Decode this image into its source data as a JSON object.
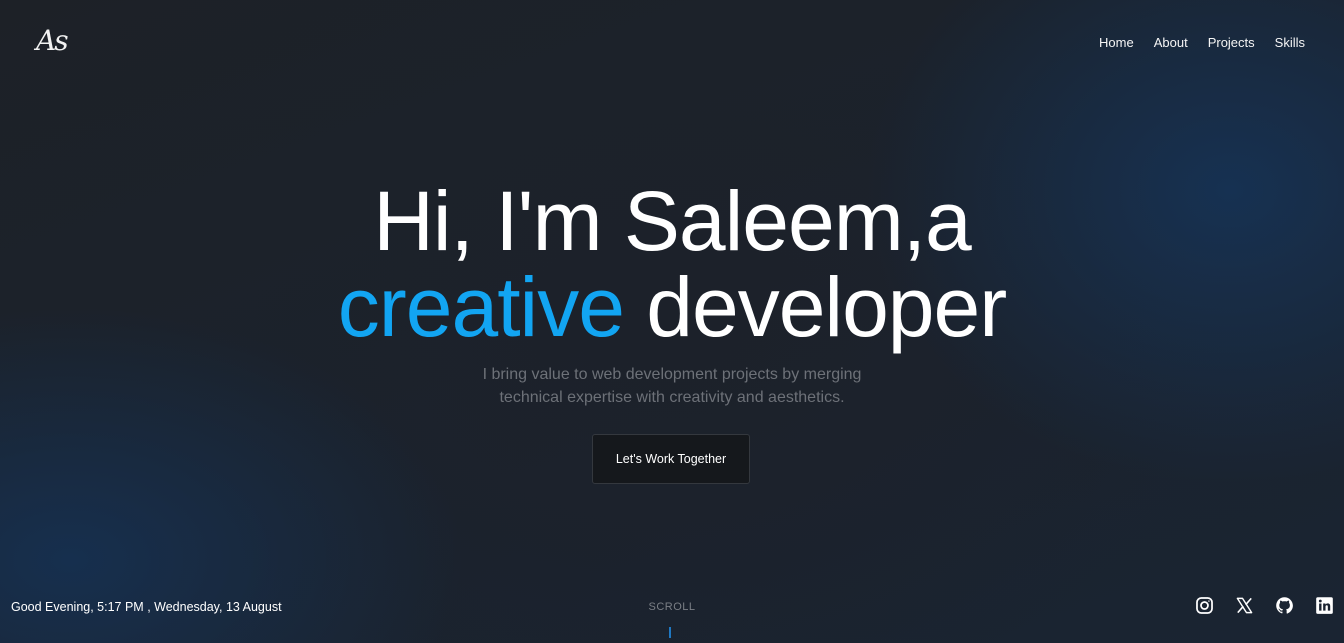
{
  "header": {
    "logo_text": "As",
    "nav": [
      {
        "label": "Home"
      },
      {
        "label": "About"
      },
      {
        "label": "Projects"
      },
      {
        "label": "Skills"
      }
    ]
  },
  "hero": {
    "line1": "Hi, I'm Saleem,a",
    "accent_word": "creative",
    "line2_rest": " developer",
    "subtitle_line1": "I bring value to web development projects by merging",
    "subtitle_line2": "technical expertise with creativity and aesthetics.",
    "cta_label": "Let's Work Together"
  },
  "footer": {
    "greeting": "Good Evening, 5:17 PM , Wednesday, 13 August",
    "scroll_label": "SCROLL",
    "social_icons": [
      "instagram-icon",
      "x-icon",
      "github-icon",
      "linkedin-icon"
    ]
  },
  "colors": {
    "accent": "#12a5f2",
    "background": "#1d2127",
    "button_bg": "#15181c"
  }
}
